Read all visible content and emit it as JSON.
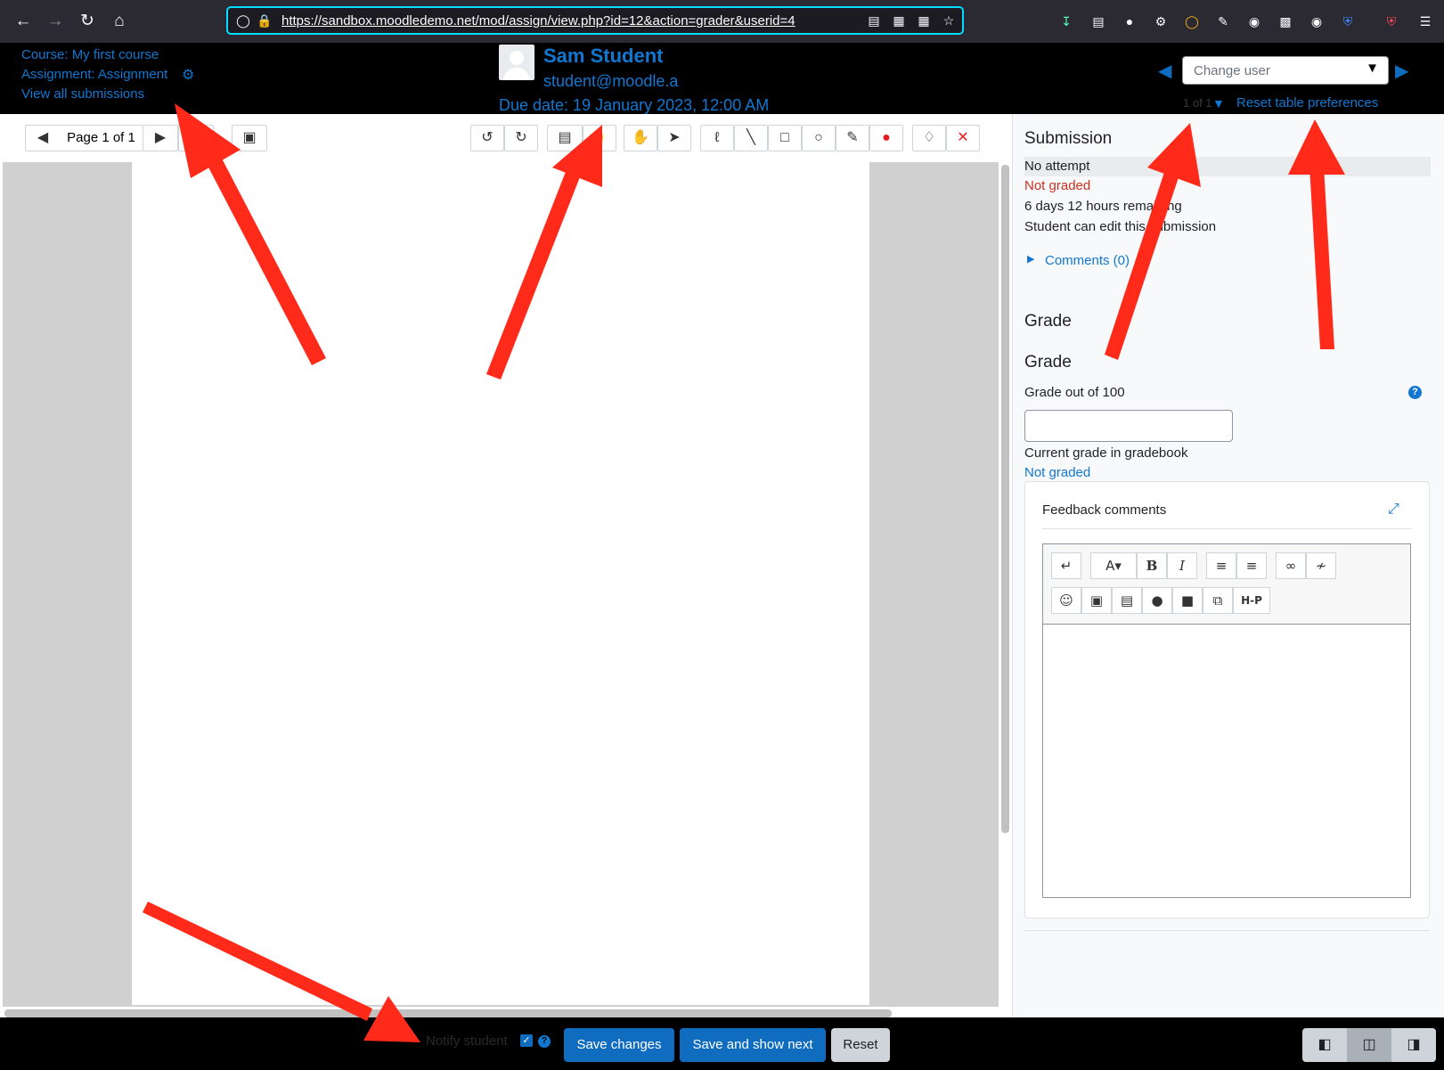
{
  "browser": {
    "url": "https://sandbox.moodledemo.net/mod/assign/view.php?id=12&action=grader&userid=4"
  },
  "header": {
    "course_link": "Course: My first course",
    "assignment_link": "Assignment: Assignment",
    "view_all": "View all submissions",
    "user_name": "Sam Student",
    "user_email": "student@moodle.a",
    "due_date": "Due date: 19 January 2023, 12:00 AM",
    "change_user_placeholder": "Change user",
    "count": "1 of 1",
    "reset_prefs": "Reset table preferences"
  },
  "pdf_toolbar": {
    "page_label": "Page 1 of 1"
  },
  "submission": {
    "heading": "Submission",
    "status": "No attempt",
    "grading_status": "Not graded",
    "time_remaining": "6 days 12 hours remaining",
    "edit_status": "Student can edit this submission",
    "comments": "Comments (0)"
  },
  "grade": {
    "heading1": "Grade",
    "heading2": "Grade",
    "grade_out_of": "Grade out of 100",
    "current_grade_label": "Current grade in gradebook",
    "current_grade_value": "Not graded",
    "feedback_title": "Feedback comments",
    "h5p_label": "H-P"
  },
  "footer": {
    "notify_label": "Notify student",
    "save_changes": "Save changes",
    "save_next": "Save and show next",
    "reset": "Reset"
  },
  "colors": {
    "link": "#1177d1",
    "primary": "#0f6cbf",
    "danger": "#ca3120",
    "annotation_arrow": "#ff2a1a"
  }
}
